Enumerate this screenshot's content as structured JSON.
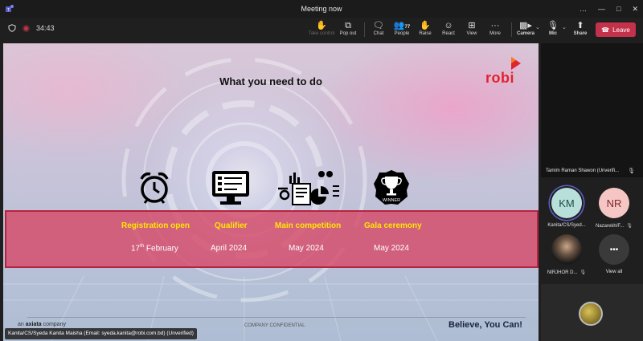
{
  "window": {
    "title": "Meeting now",
    "controls": [
      "…",
      "—",
      "□",
      "✕"
    ]
  },
  "toolbar": {
    "timer": "34:43",
    "items": [
      {
        "label": "Take control",
        "icon": "take-control-icon",
        "disabled": true
      },
      {
        "label": "Pop out",
        "icon": "pop-out-icon"
      },
      {
        "label": "Chat",
        "icon": "chat-icon"
      },
      {
        "label": "People",
        "icon": "people-icon",
        "badge": "77"
      },
      {
        "label": "Raise",
        "icon": "raise-hand-icon"
      },
      {
        "label": "React",
        "icon": "react-icon"
      },
      {
        "label": "View",
        "icon": "view-icon"
      },
      {
        "label": "More",
        "icon": "more-icon"
      },
      {
        "label": "Camera",
        "icon": "camera-icon"
      },
      {
        "label": "Mic",
        "icon": "mic-icon"
      },
      {
        "label": "Share",
        "icon": "share-icon"
      }
    ],
    "leave_label": "Leave",
    "leave_color": "#c4314b"
  },
  "slide": {
    "title": "What you need to do",
    "logo_text": "robi",
    "milestones": [
      {
        "icon": "alarm-clock-icon",
        "heading": "Registration open",
        "date_num": "17",
        "date_sup": "th",
        "date_rest": " February"
      },
      {
        "icon": "computer-checklist-icon",
        "heading": "Qualifier",
        "date": "April 2024"
      },
      {
        "icon": "analytics-icon",
        "heading": "Main competition",
        "date": "May 2024"
      },
      {
        "icon": "trophy-icon",
        "heading": "Gala ceremony",
        "date": "May 2024",
        "icon_text": "WINNER"
      }
    ],
    "footer": {
      "company_prefix": "an",
      "company_brand": "axiata",
      "company_suffix": "company",
      "confidential": "COMPANY CONFIDENTIAL",
      "slogan": "Believe, You Can!"
    },
    "presenter_label": "Kanita/CS/Syeda Kanita Maisha (Email: syeda.kanita@robi.com.bd) (Unverified)",
    "colors": {
      "band": "#d54b69",
      "heading": "#ffe600",
      "logo": "#e0232e"
    }
  },
  "participants": {
    "spotlight": {
      "name": "Tamim Raman Shawon (Unverifi..."
    },
    "grid": [
      {
        "initials": "KM",
        "name": "Kanita/CS/Syed...",
        "bg": "#b9dfda",
        "fg": "#1c4e4a",
        "ring": "#5b5fc7",
        "muted": false
      },
      {
        "initials": "NR",
        "name": "Nazarekh/F...",
        "bg": "#f5c6c4",
        "fg": "#7a2a28",
        "muted": true
      },
      {
        "initials": "",
        "name": "NIRJHOR D...",
        "bg": "#2b2b2b",
        "fg": "#fff",
        "muted": true
      },
      {
        "initials": "•••",
        "name": "View all",
        "bg": "#3a3a3a",
        "fg": "#fff",
        "muted": false
      }
    ]
  }
}
